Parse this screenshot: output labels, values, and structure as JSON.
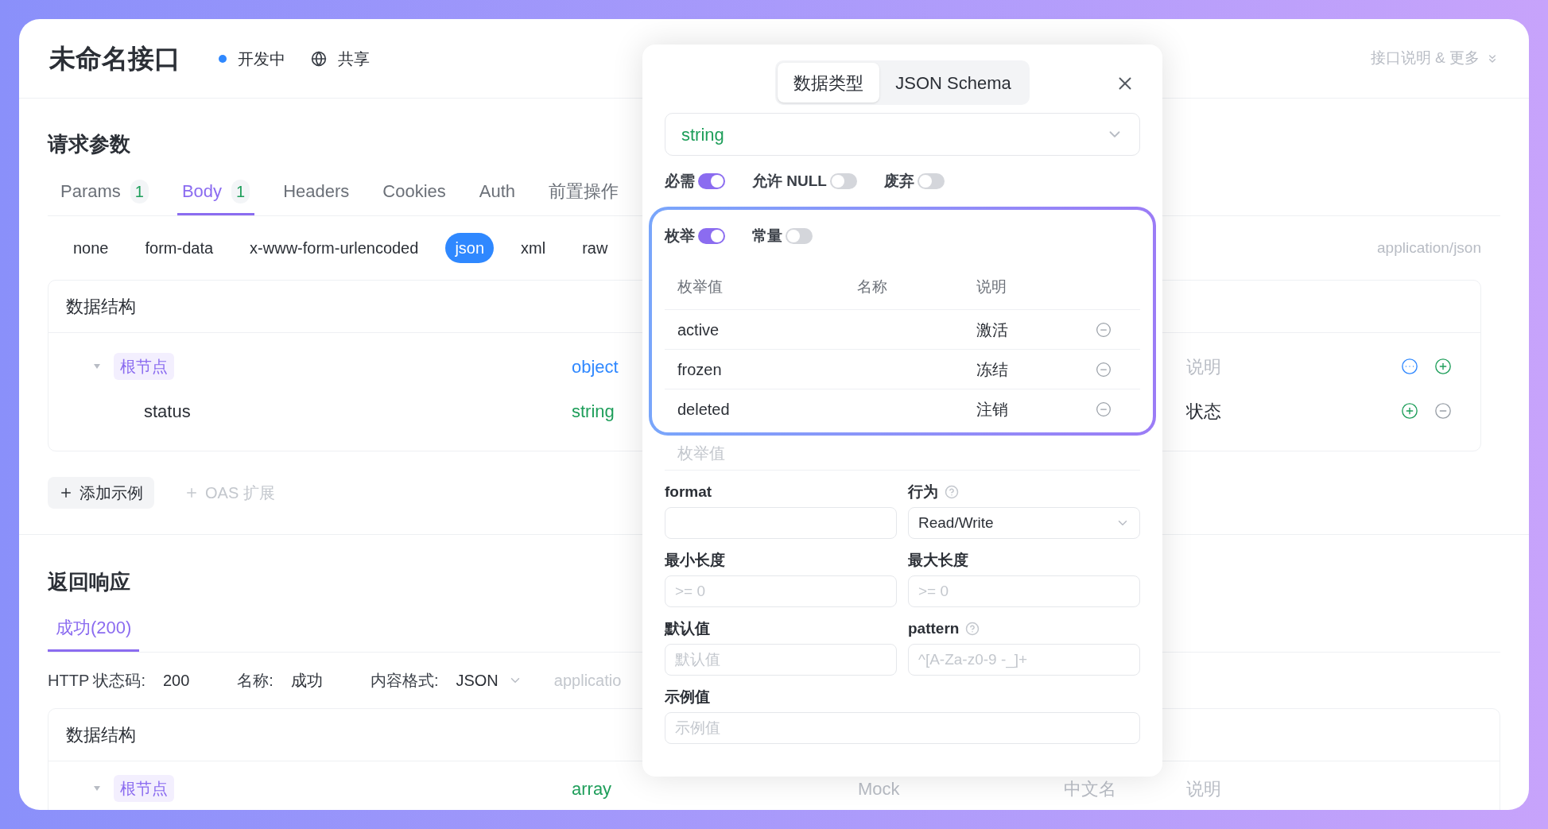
{
  "header": {
    "title": "未命名接口",
    "status": "开发中",
    "share": "共享",
    "more": "接口说明 & 更多"
  },
  "request": {
    "title": "请求参数",
    "tabs": [
      {
        "label": "Params",
        "count": "1",
        "selected": false
      },
      {
        "label": "Body",
        "count": "1",
        "selected": true
      },
      {
        "label": "Headers",
        "selected": false
      },
      {
        "label": "Cookies",
        "selected": false
      },
      {
        "label": "Auth",
        "selected": false
      },
      {
        "label": "前置操作",
        "selected": false
      }
    ],
    "body_types": [
      {
        "label": "none",
        "selected": false
      },
      {
        "label": "form-data",
        "selected": false
      },
      {
        "label": "x-www-form-urlencoded",
        "selected": false
      },
      {
        "label": "json",
        "selected": true
      },
      {
        "label": "xml",
        "selected": false
      },
      {
        "label": "raw",
        "selected": false
      }
    ],
    "content_type": "application/json",
    "schema": {
      "title": "数据结构",
      "rows": [
        {
          "kind": "root",
          "name": "根节点",
          "expanded": true,
          "type": "object",
          "color": "#2f88ff",
          "description": "说明",
          "description_placeholder": true,
          "actions": [
            {
              "kind": "more"
            },
            {
              "kind": "add"
            }
          ]
        },
        {
          "kind": "field",
          "name": "status",
          "type": "string",
          "color": "#1e9e5a",
          "description": "状态",
          "description_placeholder": false,
          "actions": [
            {
              "kind": "add"
            },
            {
              "kind": "remove"
            }
          ]
        }
      ]
    },
    "actions": [
      {
        "label": "添加示例",
        "disabled": false
      },
      {
        "label": "OAS 扩展",
        "disabled": true
      }
    ]
  },
  "response": {
    "title": "返回响应",
    "tabs": [
      {
        "label": "成功(200)",
        "selected": true
      }
    ],
    "meta": [
      {
        "label": "HTTP 状态码:",
        "value": "200"
      },
      {
        "label": "名称:",
        "value": "成功"
      },
      {
        "label": "内容格式:",
        "value": "JSON",
        "dropdown": true
      }
    ],
    "content_type": "applicatio",
    "schema": {
      "title": "数据结构",
      "rows": [
        {
          "kind": "root",
          "name": "根节点",
          "expanded": true,
          "type": "array",
          "color": "#1e9e5a",
          "mock": "Mock",
          "title_placeholder": "中文名",
          "description": "说明",
          "description_placeholder": true
        }
      ]
    }
  },
  "popover": {
    "tabs": [
      {
        "label": "数据类型",
        "selected": true
      },
      {
        "label": "JSON Schema",
        "selected": false
      }
    ],
    "type": "string",
    "switches": [
      {
        "label": "必需",
        "on": true
      },
      {
        "label": "允许 NULL",
        "on": false
      },
      {
        "label": "废弃",
        "on": false
      }
    ],
    "enum_section": {
      "switches": [
        {
          "label": "枚举",
          "on": true
        },
        {
          "label": "常量",
          "on": false
        }
      ],
      "columns": [
        "枚举值",
        "名称",
        "说明"
      ],
      "rows": [
        {
          "value": "active",
          "description": "激活"
        },
        {
          "value": "frozen",
          "description": "冻结"
        },
        {
          "value": "deleted",
          "description": "注销"
        }
      ]
    },
    "new_value_placeholder": "枚举值",
    "fields": [
      {
        "label": "format",
        "kind": "input",
        "help": false
      },
      {
        "label": "行为",
        "kind": "select",
        "help": true,
        "value": "Read/Write"
      },
      {
        "label": "最小长度",
        "kind": "input",
        "help": false,
        "placeholder": ">= 0"
      },
      {
        "label": "最大长度",
        "kind": "input",
        "help": false,
        "placeholder": ">= 0"
      },
      {
        "label": "默认值",
        "kind": "input",
        "help": false,
        "placeholder": "默认值"
      },
      {
        "label": "pattern",
        "kind": "input",
        "help": true,
        "placeholder": "^[A-Za-z0-9 -_]+"
      },
      {
        "label": "示例值",
        "kind": "wide",
        "help": false,
        "placeholder": "示例值"
      }
    ]
  }
}
